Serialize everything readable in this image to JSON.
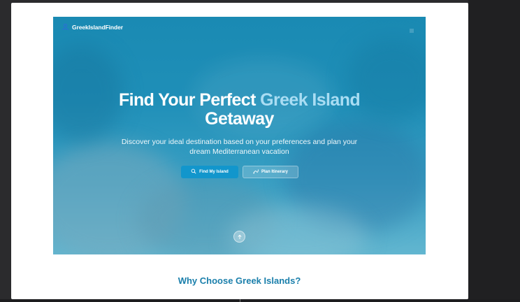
{
  "site": {
    "brand": "GreekIslandFinder"
  },
  "hero": {
    "title_line1": "Find Your Perfect ",
    "title_accent": "Greek Island",
    "title_line2": "Getaway",
    "subtitle": "Discover your ideal destination based on your preferences and plan your dream Mediterranean vacation",
    "primary_button": {
      "label": "Find My Island",
      "icon": "search-icon"
    },
    "secondary_button": {
      "label": "Plan Itinerary",
      "icon": "route-icon"
    },
    "scroll_button": {
      "icon": "arrow-up-icon"
    }
  },
  "features": {
    "title": "Why Choose Greek Islands?"
  },
  "colors": {
    "hero_top": "#1a8ab3",
    "accent_text": "#a9ddf3",
    "primary_button": "#1296cc",
    "section_title": "#1a7fab"
  }
}
